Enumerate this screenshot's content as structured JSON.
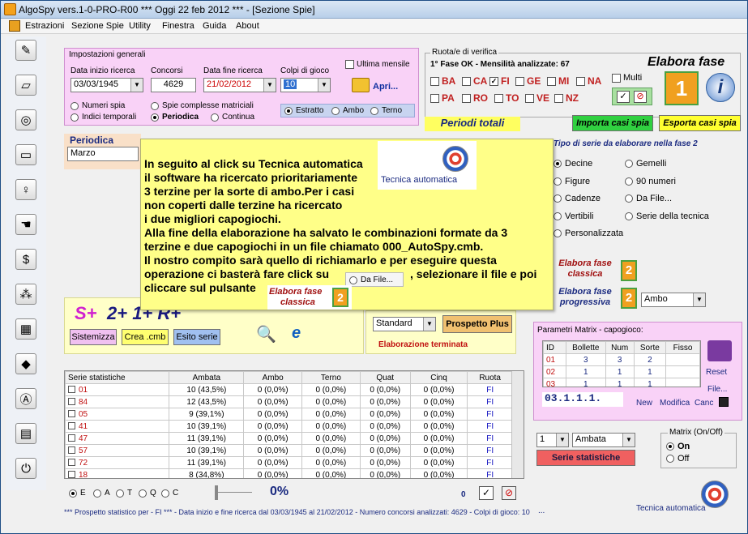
{
  "window": {
    "title": "AlgoSpy vers.1-0-PRO-R00  ***  Oggi 22 feb 2012  ***   - [Sezione Spie]"
  },
  "menu": [
    "Estrazioni",
    "Sezione Spie",
    "Utility",
    "Finestra",
    "Guida",
    "About"
  ],
  "impostazioni": {
    "title": "Impostazioni generali",
    "data_inizio_label": "Data inizio ricerca",
    "data_inizio": "03/03/1945",
    "concorsi_label": "Concorsi",
    "concorsi": "4629",
    "data_fine_label": "Data fine ricerca",
    "data_fine": "21/02/2012",
    "colpi_label": "Colpi di gioco",
    "colpi": "10",
    "ultima_mensile": "Ultima mensile",
    "apri": "Apri...",
    "r_numeri_spia": "Numeri spia",
    "r_indici": "Indici temporali",
    "r_spie_complesse": "Spie complesse matriciali",
    "r_periodica": "Periodica",
    "r_continua": "Continua",
    "r_estratto": "Estratto",
    "r_ambo": "Ambo",
    "r_terno": "Terno"
  },
  "ruote": {
    "title": "Ruota/e di verifica",
    "status": "1° Fase OK - Mensilità analizzate: 67",
    "row1": [
      "BA",
      "CA",
      "FI",
      "GE",
      "MI",
      "NA"
    ],
    "row2": [
      "PA",
      "RO",
      "TO",
      "VE",
      "NZ"
    ],
    "multi": "Multi",
    "elabora_fase": "Elabora fase",
    "fase_num": "1"
  },
  "periodi_totali": "Periodi totali",
  "importa": "Importa casi spia",
  "esporta": "Esporta casi spia",
  "periodica": {
    "title": "Periodica",
    "value": "Marzo"
  },
  "tipo_serie": {
    "title": "Tipo di serie da elaborare nella fase 2",
    "c1": [
      "Decine",
      "Figure",
      "Cadenze",
      "Vertibili",
      "Personalizzata"
    ],
    "c2": [
      "Gemelli",
      "90 numeri",
      "Da File...",
      "Serie della tecnica"
    ]
  },
  "elabora_classica": "Elabora fase classica",
  "elabora_progressiva": "Elabora fase progressiva",
  "fase2_num": "2",
  "progressiva_combo": "Ambo",
  "popup": {
    "lines": [
      "In seguito al click su Tecnica automatica",
      "il software ha ricercato prioritariamente",
      "3 terzine per la sorte di ambo.Per i casi",
      "non coperti dalle terzine ha ricercato",
      "i due migliori capogiochi.",
      "Alla fine della elaborazione ha salvato le combinazioni formate da 3",
      "terzine e due capogiochi in un file chiamato 000_AutoSpy.cmb.",
      "Il nostro compito sarà quello di richiamarlo e per eseguire questa",
      "operazione ci basterà fare click su",
      ", selezionare il file e poi",
      "cliccare sul pulsante"
    ],
    "tecnica_automatica": "Tecnica automatica",
    "da_file": "Da File...",
    "elabora_fase": "Elabora fase",
    "classica": "classica",
    "num": "2"
  },
  "splus": {
    "s": "S+",
    "rest": "2+ 1+ R+",
    "sistemizza": "Sistemizza",
    "crea": "Crea .cmb",
    "esito": "Esito serie"
  },
  "standard": "Standard",
  "prospetto_plus": "Prospetto Plus",
  "elaborazione": "Elaborazione terminata",
  "stats": {
    "headers": [
      "Serie statistiche",
      "Ambata",
      "Ambo",
      "Terno",
      "Quat",
      "Cinq",
      "Ruota"
    ],
    "rows": [
      [
        "01",
        "10 (43,5%)",
        "0 (0,0%)",
        "0 (0,0%)",
        "0 (0,0%)",
        "0 (0,0%)",
        "FI"
      ],
      [
        "84",
        "12 (43,5%)",
        "0 (0,0%)",
        "0 (0,0%)",
        "0 (0,0%)",
        "0 (0,0%)",
        "FI"
      ],
      [
        "05",
        "9 (39,1%)",
        "0 (0,0%)",
        "0 (0,0%)",
        "0 (0,0%)",
        "0 (0,0%)",
        "FI"
      ],
      [
        "41",
        "10 (39,1%)",
        "0 (0,0%)",
        "0 (0,0%)",
        "0 (0,0%)",
        "0 (0,0%)",
        "FI"
      ],
      [
        "47",
        "11 (39,1%)",
        "0 (0,0%)",
        "0 (0,0%)",
        "0 (0,0%)",
        "0 (0,0%)",
        "FI"
      ],
      [
        "57",
        "10 (39,1%)",
        "0 (0,0%)",
        "0 (0,0%)",
        "0 (0,0%)",
        "0 (0,0%)",
        "FI"
      ],
      [
        "72",
        "11 (39,1%)",
        "0 (0,0%)",
        "0 (0,0%)",
        "0 (0,0%)",
        "0 (0,0%)",
        "FI"
      ],
      [
        "18",
        "8 (34,8%)",
        "0 (0,0%)",
        "0 (0,0%)",
        "0 (0,0%)",
        "0 (0,0%)",
        "FI"
      ]
    ]
  },
  "bottom": {
    "radios": [
      "E",
      "A",
      "T",
      "Q",
      "C"
    ],
    "progress": "0%",
    "count": "0"
  },
  "status_line": "*** Prospetto statistico per  - FI ***  - Data inizio e fine ricerca dal 03/03/1945 al 21/02/2012 - Numero concorsi analizzati: 4629 - Colpi di gioco: 10",
  "matrix": {
    "title": "Parametri Matrix - capogioco:",
    "headers": [
      "ID",
      "Bollette",
      "Num",
      "Sorte",
      "Fisso"
    ],
    "rows": [
      [
        "01",
        "3",
        "3",
        "2",
        ""
      ],
      [
        "02",
        "1",
        "1",
        "1",
        ""
      ],
      [
        "03",
        "1",
        "1",
        "1",
        ""
      ]
    ],
    "code": "03.1.1.1.",
    "new": "New",
    "modifica": "Modifica",
    "canc": "Canc",
    "reset": "Reset",
    "file": "File..."
  },
  "serie_combo1": "1",
  "serie_combo2": "Ambata",
  "serie_statistiche_btn": "Serie statistiche",
  "matrix_onoff": {
    "title": "Matrix (On/Off)",
    "on": "On",
    "off": "Off"
  },
  "tecnica_auto_label": "Tecnica automatica",
  "dots": "..."
}
